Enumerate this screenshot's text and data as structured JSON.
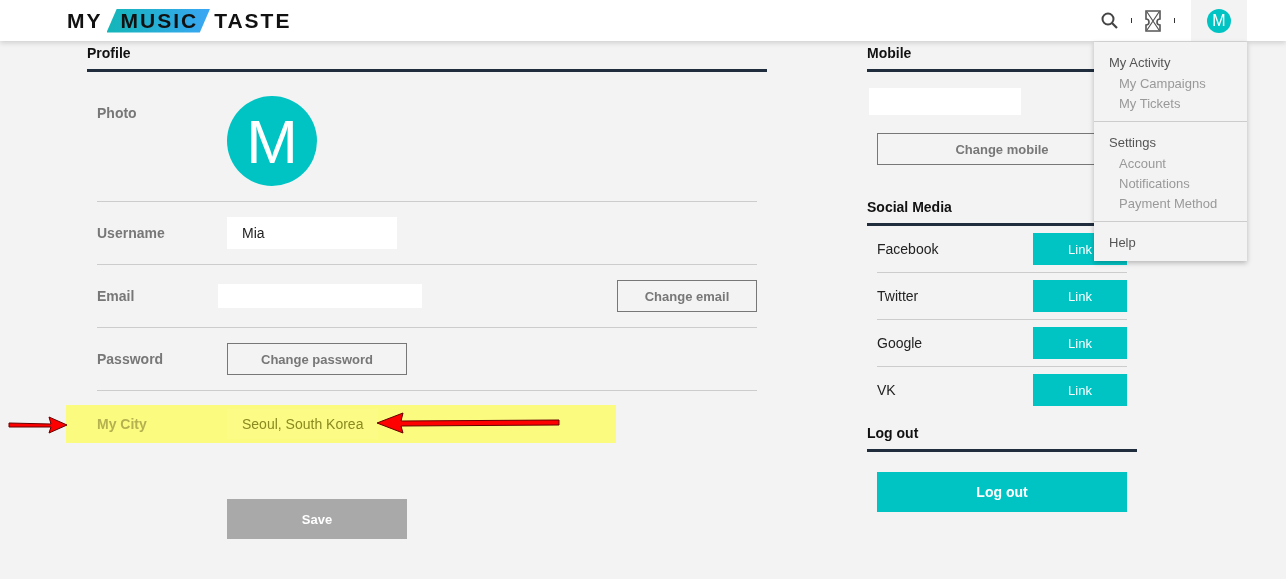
{
  "header": {
    "logo": [
      "MY",
      "MUSIC",
      "TASTE"
    ],
    "avatar_letter": "M"
  },
  "profile": {
    "heading": "Profile",
    "photo_label": "Photo",
    "avatar_letter": "M",
    "fields": [
      {
        "kind": "input",
        "label": "Username",
        "value": "Mia"
      },
      {
        "kind": "input-button",
        "label": "Email",
        "button": "Change email"
      },
      {
        "kind": "button",
        "label": "Password",
        "button": "Change password"
      }
    ],
    "city": {
      "label": "My City",
      "value": "Seoul, South Korea",
      "highlighted": true
    },
    "save": {
      "label": "Save",
      "disabled": true
    }
  },
  "mobile": {
    "heading": "Mobile",
    "button": "Change mobile"
  },
  "social": {
    "heading": "Social Media",
    "rows": [
      {
        "name": "Facebook",
        "button": "Link"
      },
      {
        "name": "Twitter",
        "button": "Link"
      },
      {
        "name": "Google",
        "button": "Link"
      },
      {
        "name": "VK",
        "button": "Link"
      }
    ]
  },
  "logout": {
    "heading": "Log out",
    "button": "Log out"
  },
  "menu": {
    "sections": [
      {
        "title": "My Activity",
        "items": [
          "My Campaigns",
          "My Tickets"
        ]
      },
      {
        "title": "Settings",
        "items": [
          "Account",
          "Notifications",
          "Payment Method"
        ]
      },
      {
        "title": "Help"
      }
    ]
  }
}
